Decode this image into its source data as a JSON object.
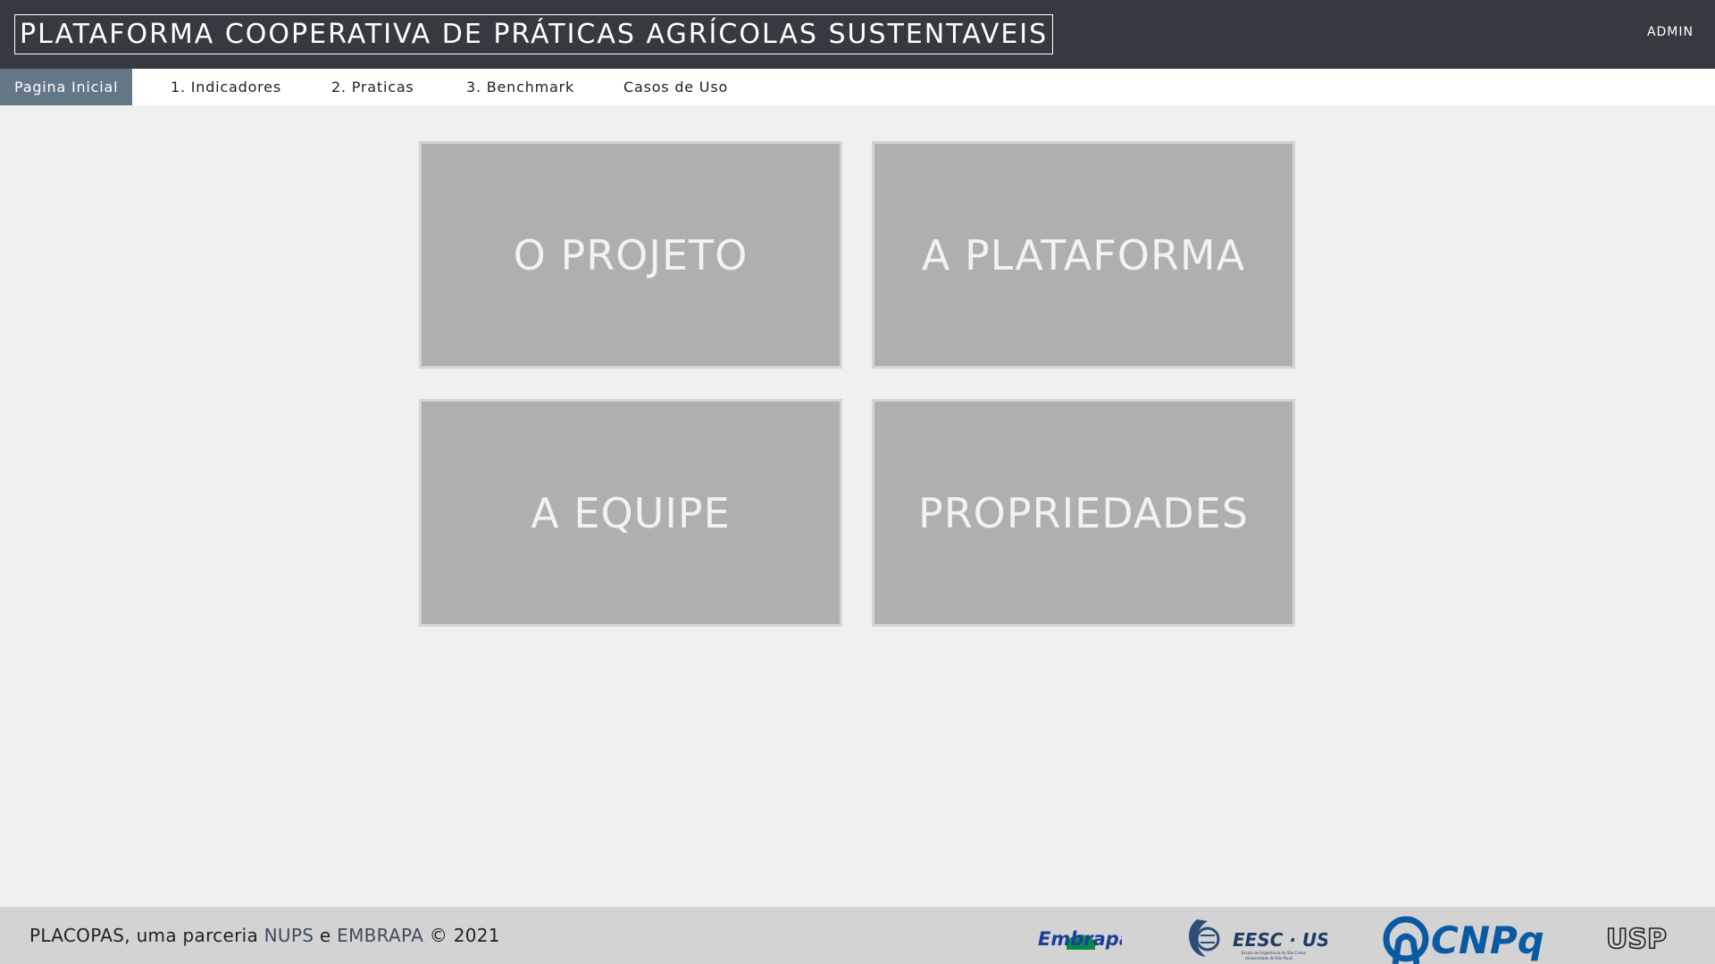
{
  "header": {
    "title": "PLATAFORMA COOPERATIVA DE PRÁTICAS AGRÍCOLAS SUSTENTAVEIS",
    "user_menu": "ADMIN"
  },
  "nav": {
    "tabs": [
      {
        "label": "Pagina Inicial",
        "active": true
      },
      {
        "label": "1. Indicadores",
        "active": false
      },
      {
        "label": "2. Praticas",
        "active": false
      },
      {
        "label": "3. Benchmark",
        "active": false
      },
      {
        "label": "Casos de Uso",
        "active": false
      }
    ]
  },
  "main": {
    "tiles": [
      {
        "label": "O PROJETO"
      },
      {
        "label": "A PLATAFORMA"
      },
      {
        "label": "A EQUIPE"
      },
      {
        "label": "PROPRIEDADES"
      }
    ]
  },
  "footer": {
    "prefix": "PLACOPAS, uma parceria ",
    "partner1": "NUPS",
    "conj": " e ",
    "partner2": "EMBRAPA",
    "suffix": " © 2021",
    "logos": {
      "embrapa": "Embrapa",
      "eesc": "EESC · USP",
      "eesc_sub": "Escola de Engenharia de São Carlos",
      "eesc_sub2": "Universidade de São Paulo",
      "cnpq": "CNPq",
      "usp": "USP"
    }
  },
  "colors": {
    "topbar": "#343a40",
    "active_tab": "#647787",
    "tile": "#afafaf",
    "footer": "#d3d3d3",
    "embrapa_blue": "#1c3e9a",
    "embrapa_green": "#0b8a47",
    "cnpq_blue": "#0a5aa3"
  }
}
